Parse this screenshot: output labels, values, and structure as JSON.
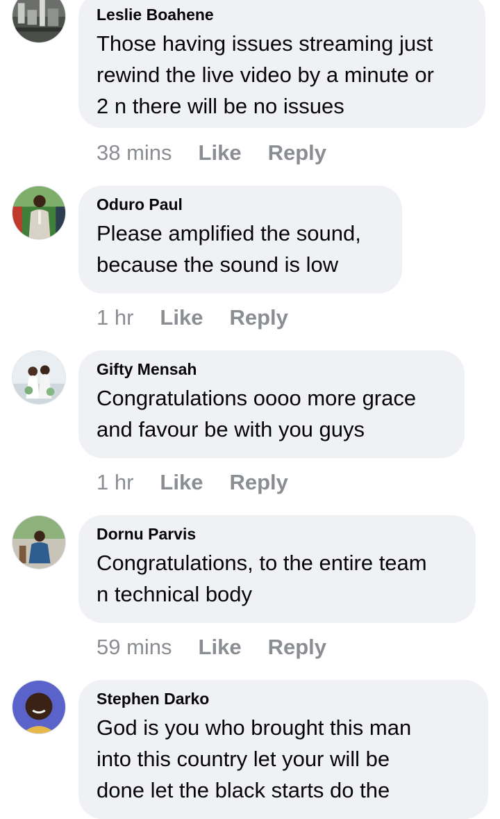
{
  "comments": [
    {
      "author": "Leslie Boahene",
      "lines": [
        "Those having issues streaming just",
        "rewind the live video by a minute or",
        "2 n there will be no issues"
      ],
      "time": "38 mins",
      "like_label": "Like",
      "reply_label": "Reply",
      "avatar": "aerial-city-photo"
    },
    {
      "author": "Oduro Paul",
      "lines": [
        "Please amplified the sound,",
        "because the sound is low"
      ],
      "time": "1 hr",
      "like_label": "Like",
      "reply_label": "Reply",
      "avatar": "man-in-suit-photo"
    },
    {
      "author": "Gifty Mensah",
      "lines": [
        "Congratulations oooo more grace",
        "and favour be with you guys"
      ],
      "time": "1 hr",
      "like_label": "Like",
      "reply_label": "Reply",
      "avatar": "wedding-couple-photo"
    },
    {
      "author": "Dornu Parvis",
      "lines": [
        "Congratulations, to the entire team",
        "n technical body"
      ],
      "time": "59 mins",
      "like_label": "Like",
      "reply_label": "Reply",
      "avatar": "man-outdoor-photo"
    },
    {
      "author": "Stephen Darko",
      "lines": [
        "God is you who brought this man",
        "into this country let your will be",
        "done let the black starts do the"
      ],
      "time": "",
      "like_label": "",
      "reply_label": "",
      "avatar": "man-portrait-photo"
    }
  ],
  "colors": {
    "bubble": "#f0f1f5",
    "text": "#050505",
    "meta": "#8a8d91"
  }
}
